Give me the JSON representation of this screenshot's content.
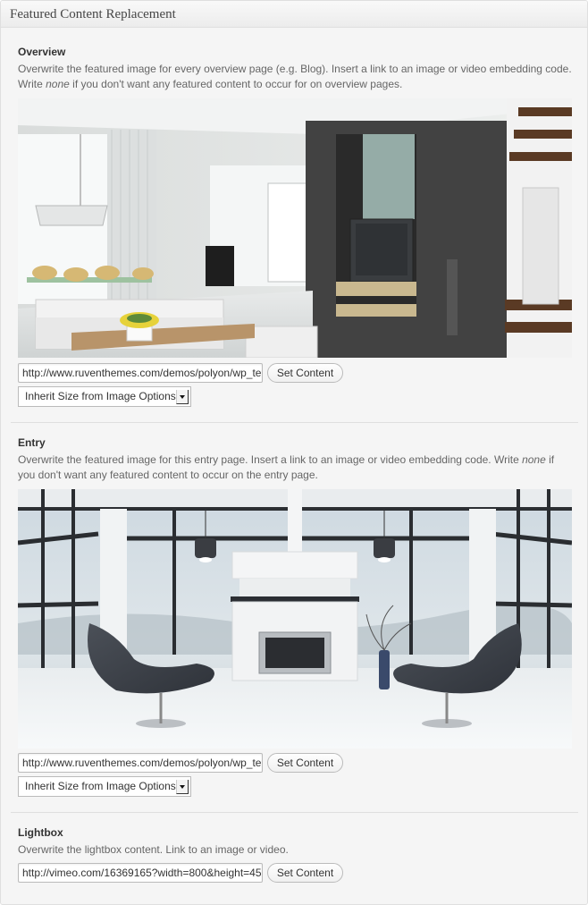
{
  "panel": {
    "title": "Featured Content Replacement"
  },
  "overview": {
    "title": "Overview",
    "desc_part1": "Overwrite the featured image for every overview page (e.g. Blog). Insert a link to an image or video embedding code. Write ",
    "desc_em": "none",
    "desc_part2": " if you don't want any featured content to occur for on overview pages.",
    "url_value": "http://www.ruventhemes.com/demos/polyon/wp_te",
    "button_label": "Set Content",
    "size_select": "Inherit Size from Image Options"
  },
  "entry": {
    "title": "Entry",
    "desc_part1": "Overwrite the featured image for this entry page. Insert a link to an image or video embedding code. Write ",
    "desc_em": "none",
    "desc_part2": " if you don't want any featured content to occur on the entry page.",
    "url_value": "http://www.ruventhemes.com/demos/polyon/wp_te",
    "button_label": "Set Content",
    "size_select": "Inherit Size from Image Options"
  },
  "lightbox": {
    "title": "Lightbox",
    "desc": "Overwrite the lightbox content. Link to an image or video.",
    "url_value": "http://vimeo.com/16369165?width=800&height=45",
    "button_label": "Set Content"
  }
}
